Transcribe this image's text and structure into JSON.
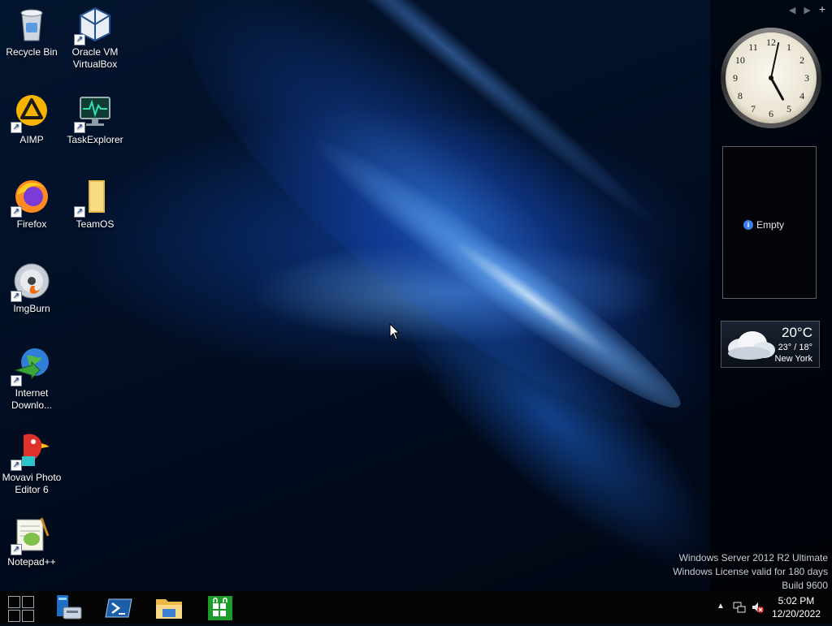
{
  "desktop_icons": [
    {
      "label": "Recycle Bin",
      "icon": "recycle-bin-icon"
    },
    {
      "label": "Oracle VM VirtualBox",
      "icon": "virtualbox-icon"
    },
    {
      "label": "AIMP",
      "icon": "aimp-icon"
    },
    {
      "label": "TaskExplorer",
      "icon": "task-explorer-icon"
    },
    {
      "label": "Firefox",
      "icon": "firefox-icon"
    },
    {
      "label": "TeamOS",
      "icon": "folder-icon"
    },
    {
      "label": "ImgBurn",
      "icon": "imgburn-icon"
    },
    {
      "label": "Internet Downlo...",
      "icon": "internet-download-manager-icon"
    },
    {
      "label": "Movavi Photo Editor 6",
      "icon": "movavi-photo-editor-icon"
    },
    {
      "label": "Notepad++",
      "icon": "notepad-plus-plus-icon"
    }
  ],
  "sidebar": {
    "prev_label": "◀",
    "next_label": "▶",
    "add_label": "+"
  },
  "gadgets": {
    "clock": {
      "hour": 5,
      "minute": 2,
      "numerals": [
        "12",
        "1",
        "2",
        "3",
        "4",
        "5",
        "6",
        "7",
        "8",
        "9",
        "10",
        "11"
      ]
    },
    "slideshow": {
      "status": "Empty",
      "info_glyph": "i"
    },
    "weather": {
      "temperature": "20°C",
      "range": "23° / 18°",
      "city": "New York"
    }
  },
  "watermark": {
    "line1": "Windows Server 2012 R2 Ultimate",
    "line2": "Windows License valid for 180 days",
    "line3": "Build 9600"
  },
  "taskbar": {
    "apps": [
      {
        "name": "server-manager",
        "icon": "server-manager-icon"
      },
      {
        "name": "powershell",
        "icon": "powershell-icon"
      },
      {
        "name": "file-explorer",
        "icon": "file-explorer-icon"
      },
      {
        "name": "store",
        "icon": "store-icon"
      }
    ],
    "tray": {
      "overflow_glyph": "▲",
      "time": "5:02 PM",
      "date": "12/20/2022"
    }
  },
  "colors": {
    "taskbar": "#050505",
    "store_green": "#1e9c2b",
    "powershell_blue": "#1c5fa8"
  }
}
